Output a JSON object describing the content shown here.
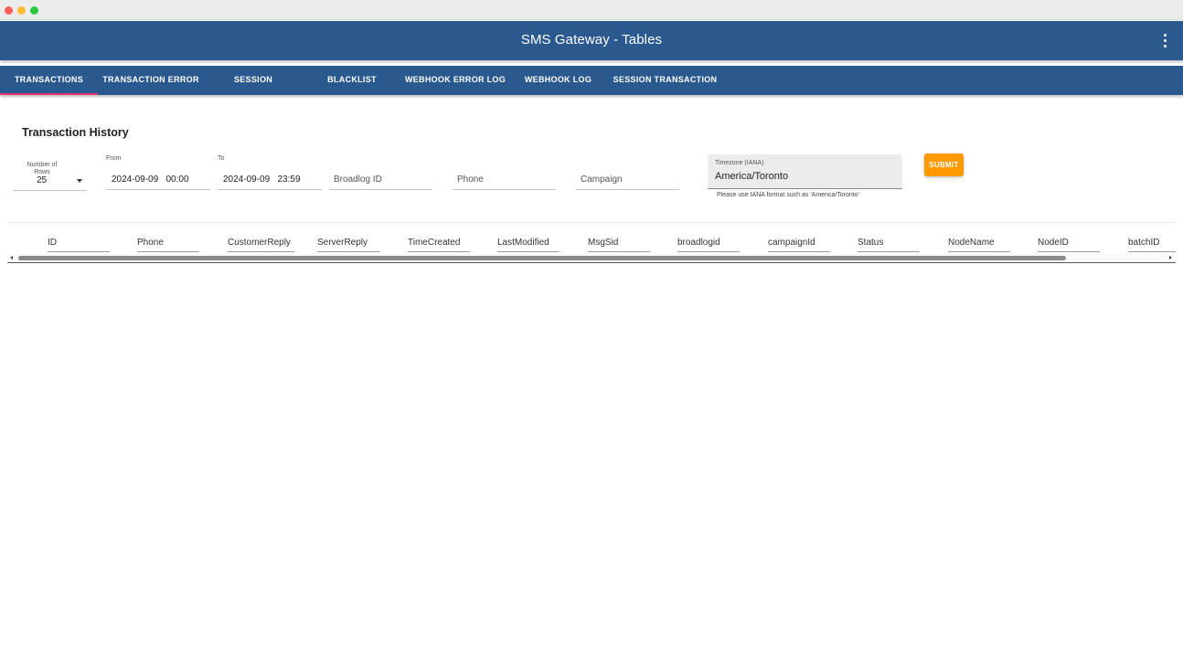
{
  "app": {
    "title": "SMS Gateway - Tables",
    "menu_icon": "more-vert-icon"
  },
  "tabs": [
    {
      "label": "TRANSACTIONS",
      "active": true
    },
    {
      "label": "TRANSACTION ERROR",
      "active": false
    },
    {
      "label": "SESSION",
      "active": false
    },
    {
      "label": "BLACKLIST",
      "active": false
    },
    {
      "label": "WEBHOOK ERROR LOG",
      "active": false
    },
    {
      "label": "WEBHOOK LOG",
      "active": false
    },
    {
      "label": "SESSION TRANSACTION",
      "active": false
    }
  ],
  "filters": {
    "section_title": "Transaction History",
    "rows": {
      "label": "Number of Rows",
      "value": "25"
    },
    "from": {
      "label": "From",
      "value": "2024-09-09   00:00"
    },
    "to": {
      "label": "To",
      "value": "2024-09-09   23:59"
    },
    "broadlog": {
      "placeholder": "Broadlog ID"
    },
    "phone": {
      "placeholder": "Phone"
    },
    "campaign": {
      "placeholder": "Campaign"
    },
    "timezone": {
      "label": "Timezone (IANA)",
      "value": "America/Toronto",
      "help": "Please use IANA format such as 'America/Toronto'"
    },
    "submit_label": "SUBMIT"
  },
  "table": {
    "columns": [
      "ID",
      "Phone",
      "CustomerReply",
      "ServerReply",
      "TimeCreated",
      "LastModified",
      "MsgSid",
      "broadlogid",
      "campaignId",
      "Status",
      "NodeName",
      "NodeID",
      "batchID"
    ]
  },
  "colors": {
    "appbar": "#2a5990",
    "active_tab_indicator": "#e8336a",
    "submit": "#ff9900"
  }
}
